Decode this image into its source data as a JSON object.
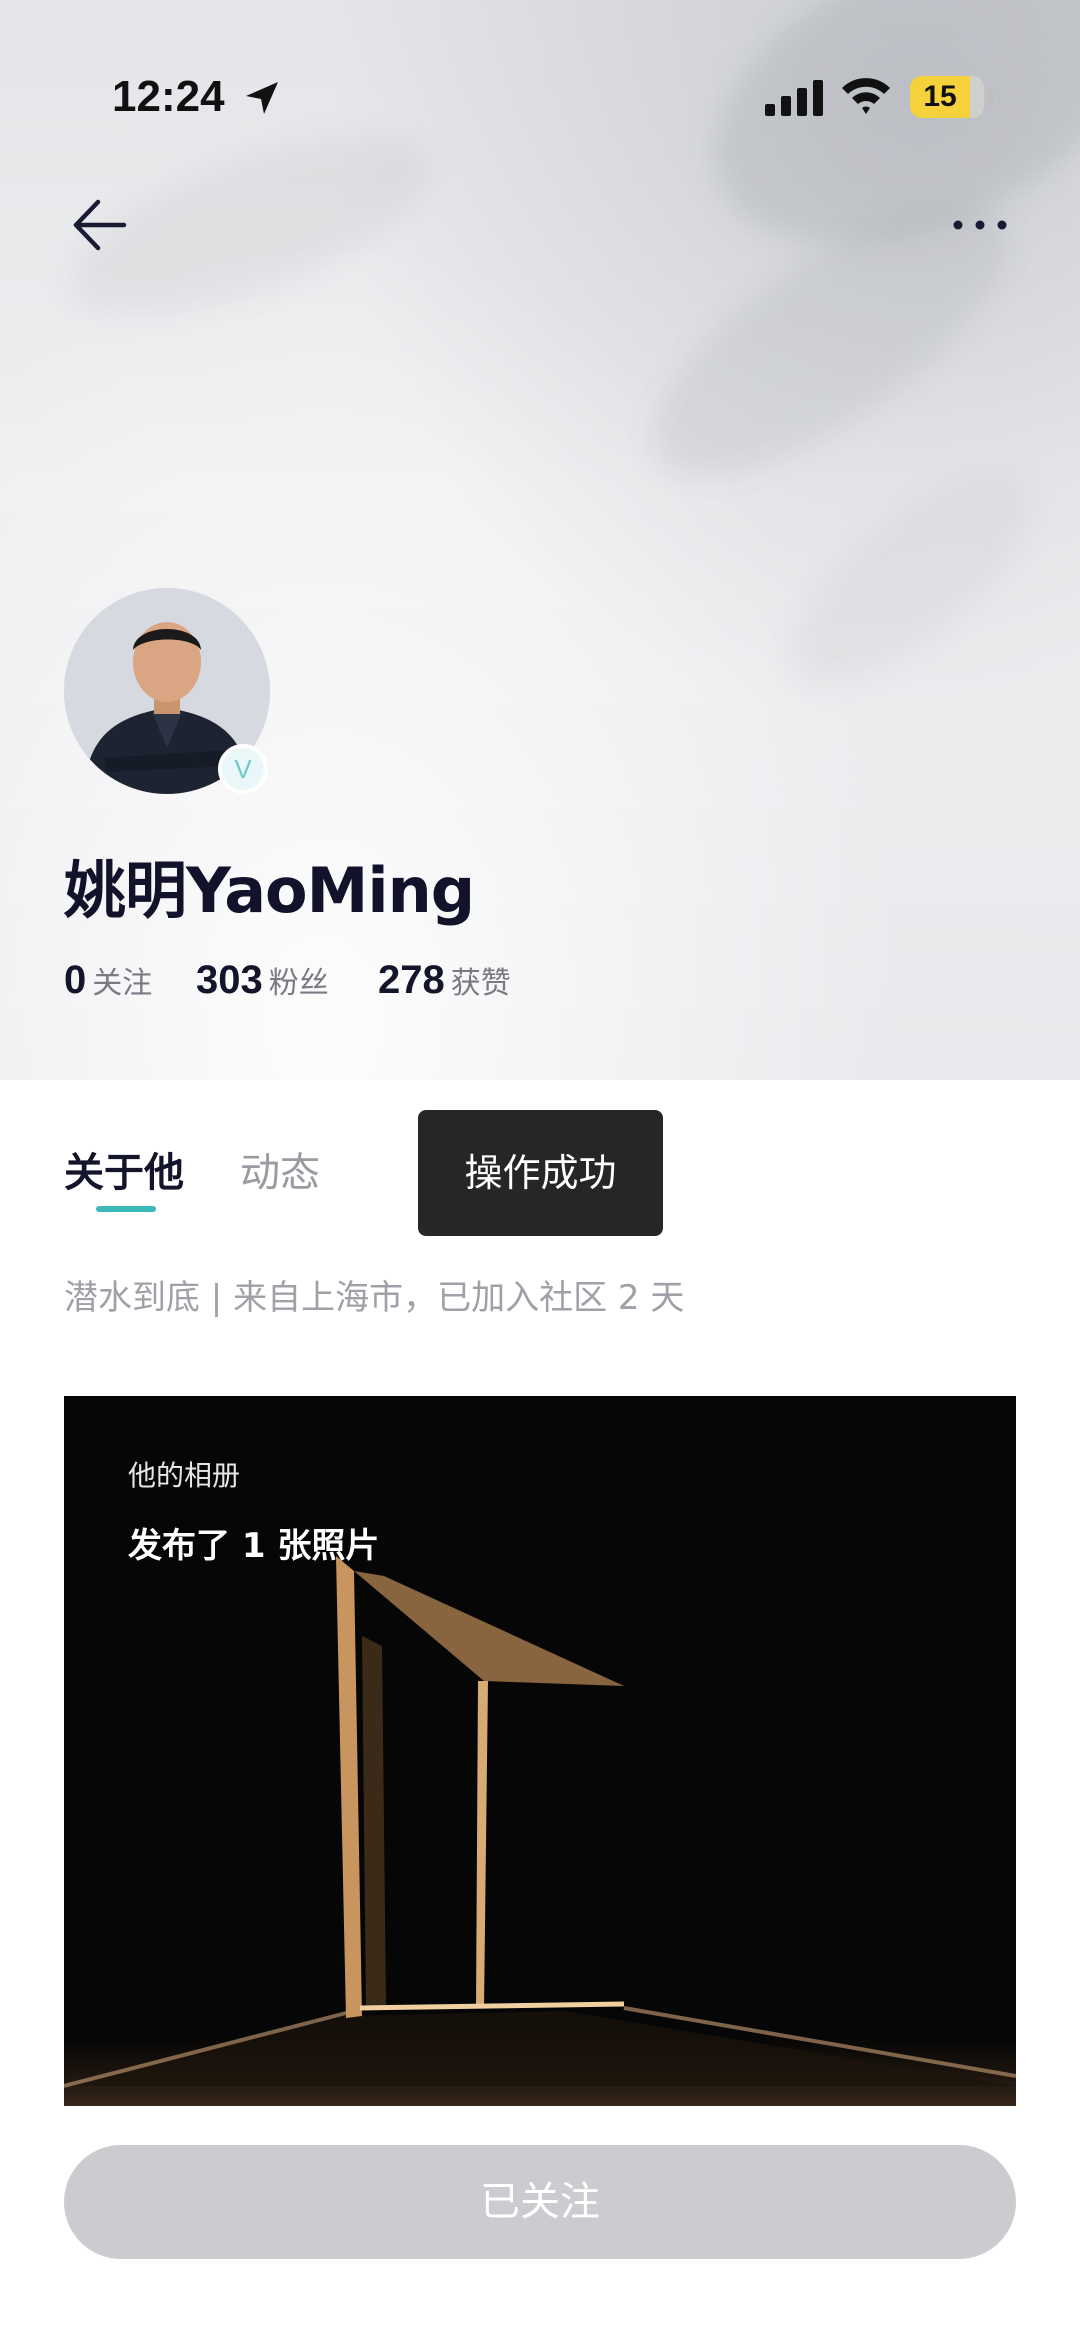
{
  "status_bar": {
    "time": "12:24",
    "battery": "15",
    "icons": [
      "location-arrow-icon",
      "cellular-signal-icon",
      "wifi-icon",
      "battery-icon"
    ]
  },
  "nav": {
    "back_icon": "back-arrow-icon",
    "more_icon": "more-dots-icon"
  },
  "profile": {
    "name": "姚明YaoMing",
    "verified_badge": "V",
    "stats": [
      {
        "value": "0",
        "label": "关注"
      },
      {
        "value": "303",
        "label": "粉丝"
      },
      {
        "value": "278",
        "label": "获赞"
      }
    ]
  },
  "tabs": [
    {
      "label": "关于他",
      "active": true
    },
    {
      "label": "动态",
      "active": false
    }
  ],
  "toast": "操作成功",
  "bio": "潜水到底 | 来自上海市，已加入社区 2 天",
  "album": {
    "caption": "他的相册",
    "count_text": "发布了 1 张照片"
  },
  "follow_button": "已关注",
  "colors": {
    "accent": "#3bb8b8",
    "toast_bg": "#262626",
    "follow_button_bg": "#cbcbd0",
    "battery": "#f5d23c"
  }
}
